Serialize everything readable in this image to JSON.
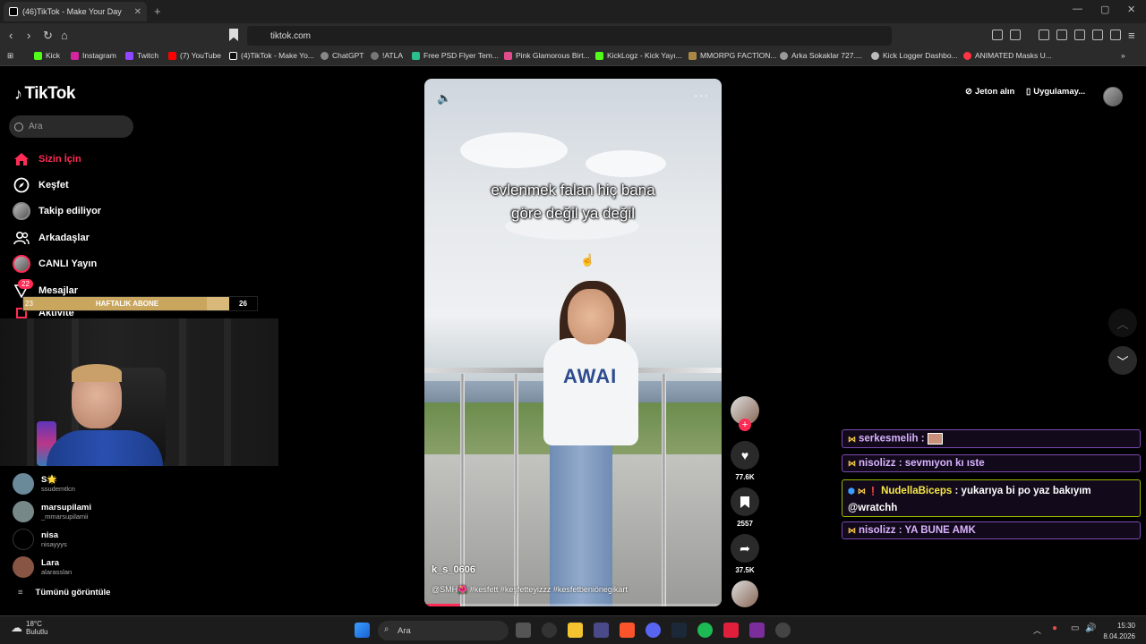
{
  "browser": {
    "tab_title": "(46)TikTok - Make Your Day",
    "tab_close": "✕",
    "new_tab": "+",
    "url": "tiktok.com",
    "bookmarks": [
      {
        "label": "Kick",
        "color": "#53fc18"
      },
      {
        "label": "Instagram",
        "color": "#d6249f"
      },
      {
        "label": "Twitch",
        "color": "#9146ff"
      },
      {
        "label": "(7) YouTube",
        "color": "#ff0000"
      },
      {
        "label": "(4)TikTok - Make Yo...",
        "color": "#111111"
      },
      {
        "label": "ChatGPT",
        "color": "#888888"
      },
      {
        "label": "!ATLA",
        "color": "#777777"
      },
      {
        "label": "Free PSD Flyer Tem...",
        "color": "#2bbf8a"
      },
      {
        "label": "Pink Glamorous Birt...",
        "color": "#e04b8a"
      },
      {
        "label": "KickLogz - Kick Yayı...",
        "color": "#53fc18"
      },
      {
        "label": "MMORPG FACTİON...",
        "color": "#aa8844"
      },
      {
        "label": "Arka Sokaklar 727....",
        "color": "#999999"
      },
      {
        "label": "Kick Logger Dashbo...",
        "color": "#bbbbbb"
      },
      {
        "label": "ANIMATED Masks U...",
        "color": "#ff3344"
      }
    ]
  },
  "sidebar": {
    "logo": "TikTok",
    "search_placeholder": "Ara",
    "nav": [
      {
        "label": "Sizin İçin",
        "active": true
      },
      {
        "label": "Keşfet"
      },
      {
        "label": "Takip ediliyor"
      },
      {
        "label": "Arkadaşlar"
      },
      {
        "label": "CANLI Yayın"
      },
      {
        "label": "Mesajlar"
      },
      {
        "label": "Aktivite"
      }
    ],
    "messages_badge": "22",
    "following": [
      {
        "name": "S🌟",
        "handle": "ssudemtlcn",
        "color": "#6a8a9a"
      },
      {
        "name": "marsupilami",
        "handle": "_mmarsupilamii",
        "color": "#778888"
      },
      {
        "name": "nisa",
        "handle": "nisayyys",
        "color": "#000000"
      },
      {
        "name": "Lara",
        "handle": "alarasslan",
        "color": "#885544"
      }
    ],
    "see_all": "Tümünü görüntüle"
  },
  "overlay": {
    "sub_goal_label": "HAFTALIK ABONE",
    "sub_goal_current": "23",
    "sub_goal_target": "26",
    "sub_goal_progress": 0.885
  },
  "video": {
    "caption": "evlenmek falan hiç bana\ngöre değil ya değil",
    "author": "k_s_0606",
    "description": "@SMH🌺 #kesfett #keşfetteyizzz #kesfetbeniönegikart",
    "progress": 0.12,
    "likes": "77.6K",
    "bookmarks": "2557",
    "shares": "37.5K",
    "shirt_text": "AWAI"
  },
  "header": {
    "coins": "Jeton alın",
    "app": "Uygulamay..."
  },
  "chat": [
    {
      "user": "serkesmelih",
      "msg": ":",
      "special": false
    },
    {
      "user": "nisolizz",
      "msg": ": sevmıyon kı ıste",
      "special": false
    },
    {
      "user": "NudellaBiceps",
      "msg": ": yukarıya bi po yaz bakıyım @wratchh",
      "special": true
    },
    {
      "user": "nisolizz",
      "msg": ": YA BUNE AMK",
      "special": false
    }
  ],
  "taskbar": {
    "temp": "18°C",
    "weather": "Bulutlu",
    "search": "Ara",
    "time": "15:30",
    "date": "8.04.2026"
  }
}
